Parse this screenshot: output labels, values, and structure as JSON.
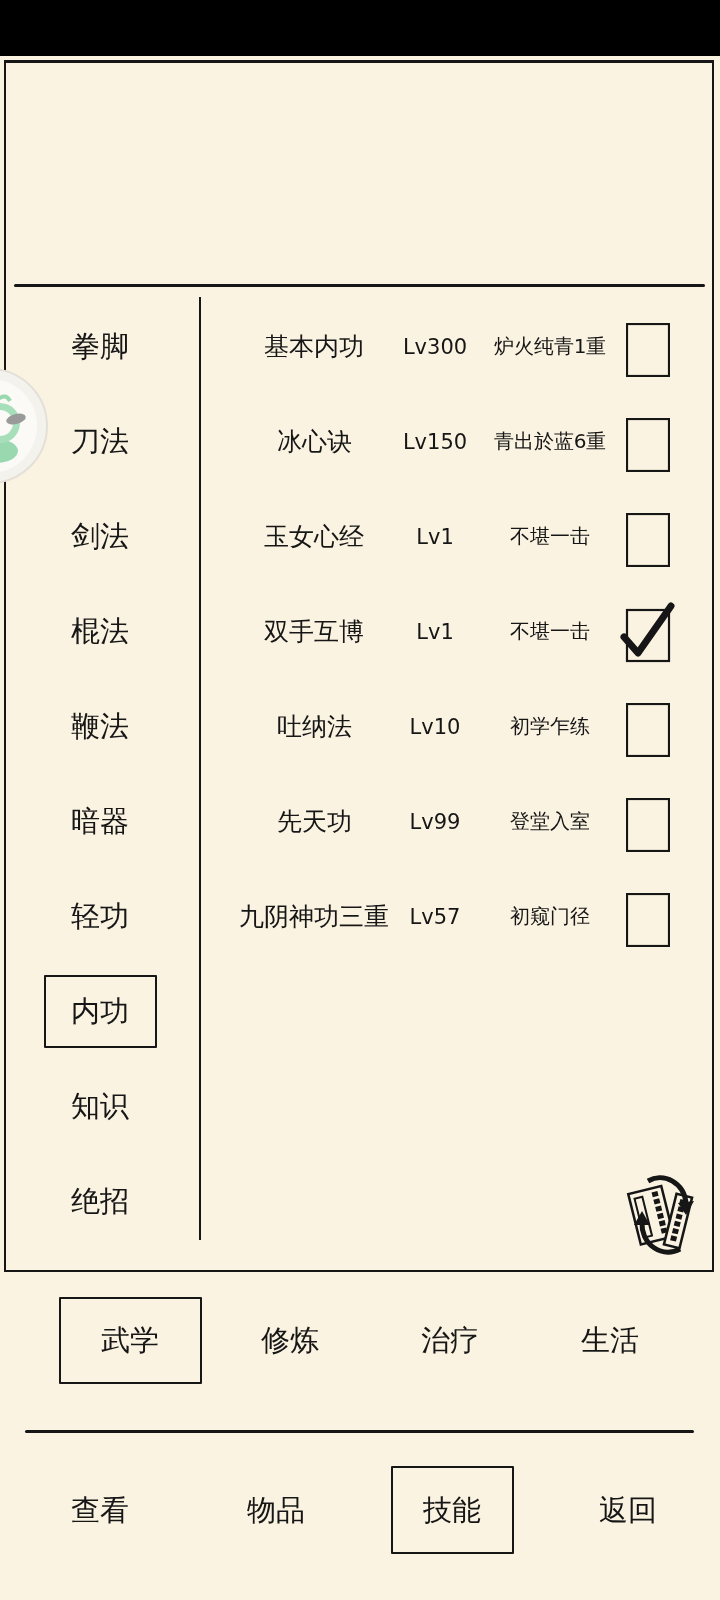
{
  "sidebar": {
    "items": [
      {
        "label": "拳脚",
        "selected": false
      },
      {
        "label": "刀法",
        "selected": false
      },
      {
        "label": "剑法",
        "selected": false
      },
      {
        "label": "棍法",
        "selected": false
      },
      {
        "label": "鞭法",
        "selected": false
      },
      {
        "label": "暗器",
        "selected": false
      },
      {
        "label": "轻功",
        "selected": false
      },
      {
        "label": "内功",
        "selected": true
      },
      {
        "label": "知识",
        "selected": false
      },
      {
        "label": "绝招",
        "selected": false
      }
    ]
  },
  "skills": [
    {
      "name": "基本内功",
      "lv": "Lv300",
      "rank": "炉火纯青1重",
      "checked": false
    },
    {
      "name": "冰心诀",
      "lv": "Lv150",
      "rank": "青出於蓝6重",
      "checked": false
    },
    {
      "name": "玉女心经",
      "lv": "Lv1",
      "rank": "不堪一击",
      "checked": false
    },
    {
      "name": "双手互博",
      "lv": "Lv1",
      "rank": "不堪一击",
      "checked": true
    },
    {
      "name": "吐纳法",
      "lv": "Lv10",
      "rank": "初学乍练",
      "checked": false
    },
    {
      "name": "先天功",
      "lv": "Lv99",
      "rank": "登堂入室",
      "checked": false
    },
    {
      "name": "九阴神功三重",
      "lv": "Lv57",
      "rank": "初窥门径",
      "checked": false
    }
  ],
  "sub_tabs": [
    {
      "label": "武学",
      "selected": true
    },
    {
      "label": "修炼",
      "selected": false
    },
    {
      "label": "治疗",
      "selected": false
    },
    {
      "label": "生活",
      "selected": false
    }
  ],
  "bottom_nav": [
    {
      "label": "查看",
      "selected": false
    },
    {
      "label": "物品",
      "selected": false
    },
    {
      "label": "技能",
      "selected": true
    },
    {
      "label": "返回",
      "selected": false
    }
  ]
}
